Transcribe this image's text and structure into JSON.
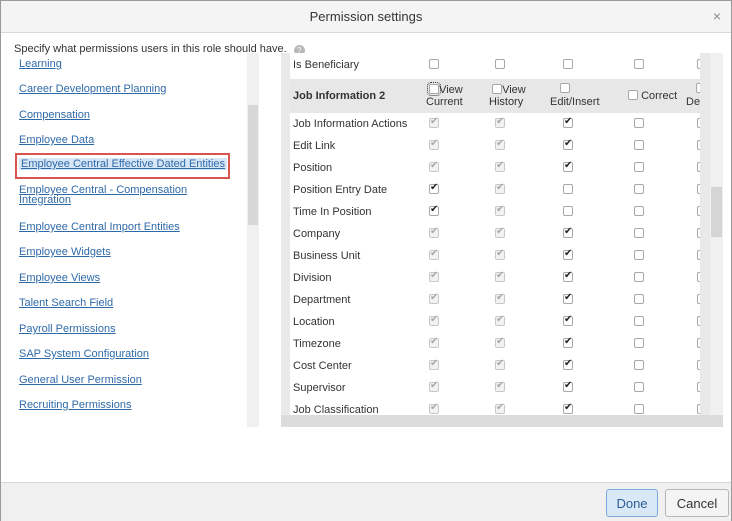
{
  "dialog": {
    "title": "Permission settings",
    "close_glyph": "×",
    "instruction": "Specify what permissions users in this role should have.",
    "help_glyph": "?"
  },
  "nav": {
    "items": [
      {
        "label": "Learning"
      },
      {
        "label": "Career Development Planning"
      },
      {
        "label": "Compensation"
      },
      {
        "label": "Employee Data"
      },
      {
        "label": "Employee Central Effective Dated Entities",
        "selected": true
      },
      {
        "label": "Employee Central - Compensation Integration"
      },
      {
        "label": "Employee Central Import Entities"
      },
      {
        "label": "Employee Widgets"
      },
      {
        "label": "Employee Views"
      },
      {
        "label": "Talent Search Field"
      },
      {
        "label": "Payroll Permissions"
      },
      {
        "label": "SAP System Configuration"
      },
      {
        "label": "General User Permission"
      },
      {
        "label": "Recruiting Permissions"
      }
    ]
  },
  "table": {
    "top_row_label": "Is Beneficiary",
    "section_title": "Job Information 2",
    "columns": [
      {
        "label_line1": "View",
        "label_line2": "Current"
      },
      {
        "label_line1": "View",
        "label_line2": "History"
      },
      {
        "label_line1": "",
        "label_line2": "Edit/Insert"
      },
      {
        "label_line1": "Correct",
        "label_line2": ""
      },
      {
        "label_line1": "",
        "label_line2": "Delete"
      }
    ],
    "rows": [
      {
        "label": "Job Information Actions",
        "state": [
          "dc",
          "dc",
          "c",
          "u",
          "u"
        ]
      },
      {
        "label": "Edit Link",
        "state": [
          "dc",
          "dc",
          "c",
          "u",
          "u"
        ]
      },
      {
        "label": "Position",
        "state": [
          "dc",
          "dc",
          "c",
          "u",
          "u"
        ]
      },
      {
        "label": "Position Entry Date",
        "state": [
          "c",
          "dc",
          "u",
          "u",
          "u"
        ]
      },
      {
        "label": "Time In Position",
        "state": [
          "c",
          "dc",
          "u",
          "u",
          "u"
        ]
      },
      {
        "label": "Company",
        "state": [
          "dc",
          "dc",
          "c",
          "u",
          "u"
        ]
      },
      {
        "label": "Business Unit",
        "state": [
          "dc",
          "dc",
          "c",
          "u",
          "u"
        ]
      },
      {
        "label": "Division",
        "state": [
          "dc",
          "dc",
          "c",
          "u",
          "u"
        ]
      },
      {
        "label": "Department",
        "state": [
          "dc",
          "dc",
          "c",
          "u",
          "u"
        ]
      },
      {
        "label": "Location",
        "state": [
          "dc",
          "dc",
          "c",
          "u",
          "u"
        ]
      },
      {
        "label": "Timezone",
        "state": [
          "dc",
          "dc",
          "c",
          "u",
          "u"
        ]
      },
      {
        "label": "Cost Center",
        "state": [
          "dc",
          "dc",
          "c",
          "u",
          "u"
        ]
      },
      {
        "label": "Supervisor",
        "state": [
          "dc",
          "dc",
          "c",
          "u",
          "u"
        ]
      },
      {
        "label": "Job Classification",
        "state": [
          "dc",
          "dc",
          "c",
          "u",
          "u"
        ]
      }
    ]
  },
  "footer": {
    "done_label": "Done",
    "cancel_label": "Cancel"
  }
}
